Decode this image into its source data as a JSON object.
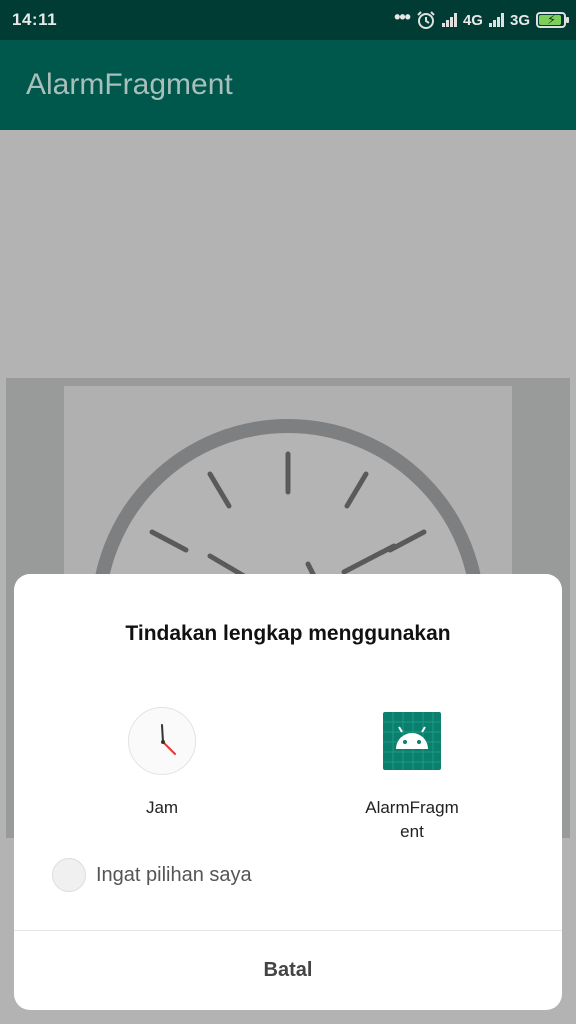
{
  "status_bar": {
    "time": "14:11",
    "dots": "•••",
    "network_1": "4G",
    "network_2": "3G",
    "icons": [
      "alarm-icon",
      "signal-icon",
      "battery-charging-icon"
    ]
  },
  "app_bar": {
    "title": "AlarmFragment"
  },
  "dialog": {
    "title": "Tindakan lengkap menggunakan",
    "options": [
      {
        "label": "Jam",
        "icon": "clock-app-icon"
      },
      {
        "label": "AlarmFragment",
        "label_line1": "AlarmFragm",
        "label_line2": "ent",
        "icon": "android-app-icon"
      }
    ],
    "remember_label": "Ingat pilihan saya",
    "cancel_label": "Batal"
  },
  "colors": {
    "status_bar": "#003c34",
    "app_bar": "#00574b",
    "scrim": "#b3b3b3",
    "android_icon_bg": "#0b7f6e"
  }
}
